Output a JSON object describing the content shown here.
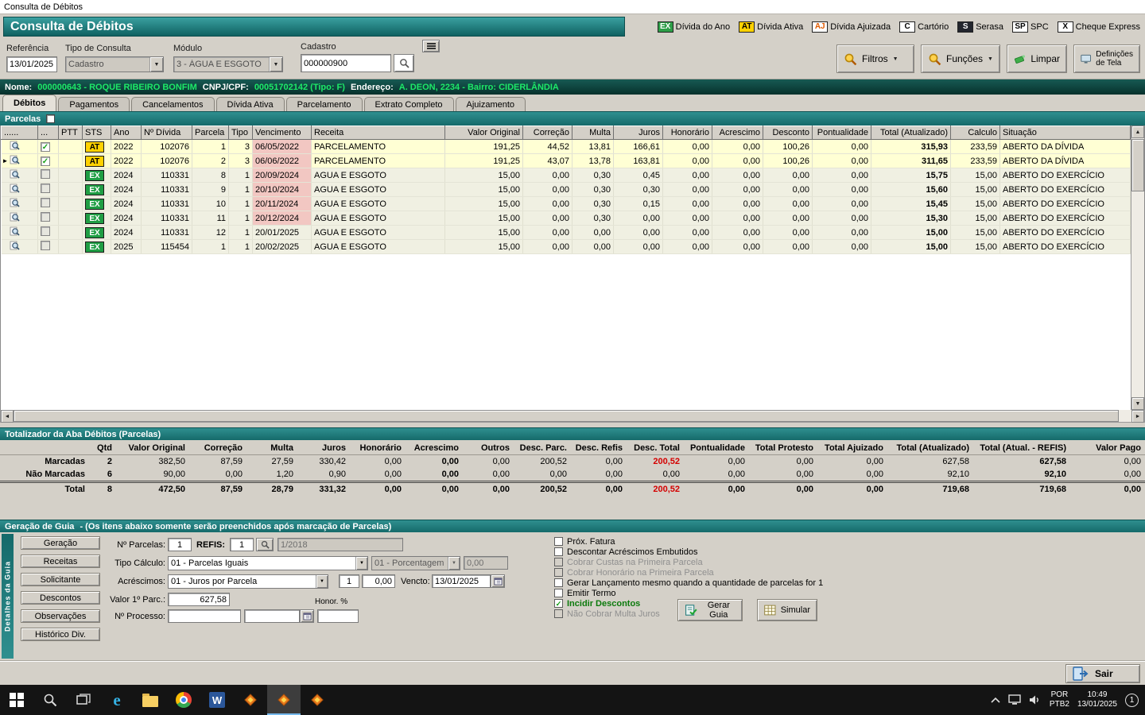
{
  "window": {
    "title": "Consulta de Débitos"
  },
  "header": {
    "title": "Consulta de Débitos",
    "legend": [
      {
        "badge": "EX",
        "label": "Dívida do Ano",
        "bg": "#2e9e48",
        "fg": "#ffffff"
      },
      {
        "badge": "AT",
        "label": "Dívida Ativa",
        "bg": "#ffd200",
        "fg": "#000000"
      },
      {
        "badge": "AJ",
        "label": "Dívida Ajuizada",
        "bg": "#ffffff",
        "fg": "#e05a00"
      },
      {
        "badge": "C",
        "label": "Cartório",
        "bg": "#ffffff",
        "fg": "#000000"
      },
      {
        "badge": "S",
        "label": "Serasa",
        "bg": "#23262e",
        "fg": "#ffffff"
      },
      {
        "badge": "SP",
        "label": "SPC",
        "bg": "#ffffff",
        "fg": "#000000"
      },
      {
        "badge": "X",
        "label": "Cheque Express",
        "bg": "#ffffff",
        "fg": "#000000"
      }
    ]
  },
  "filters": {
    "referencia": {
      "label": "Referência",
      "value": "13/01/2025"
    },
    "tipo_consulta": {
      "label": "Tipo de Consulta",
      "value": "Cadastro"
    },
    "modulo": {
      "label": "Módulo",
      "value": "3 - ÁGUA E ESGOTO"
    },
    "cadastro": {
      "label": "Cadastro",
      "value": "000000900"
    }
  },
  "toolbar": {
    "filtros": "Filtros",
    "funcoes": "Funções",
    "limpar": "Limpar",
    "definicoes_line1": "Definições",
    "definicoes_line2": "de Tela"
  },
  "pessoa": {
    "nome_label": "Nome:",
    "nome": "000000643 - ROQUE RIBEIRO BONFIM",
    "doc_label": "CNPJ/CPF:",
    "doc": "00051702142 (Tipo: F)",
    "endereco_label": "Endereço:",
    "endereco": "A. DEON, 2234 - Bairro: CIDERLÂNDIA"
  },
  "tabs": {
    "items": [
      "Débitos",
      "Pagamentos",
      "Cancelamentos",
      "Dívida Ativa",
      "Parcelamento",
      "Extrato Completo",
      "Ajuizamento"
    ],
    "active_index": 0
  },
  "parcelas": {
    "title": "Parcelas"
  },
  "icons": {
    "dropdown_arrow": "▼",
    "scroll_up": "▲",
    "scroll_down": "▼",
    "scroll_left": "◄",
    "scroll_right": "►",
    "check": "✓",
    "current_row": "►"
  },
  "debitos": {
    "columns": [
      "......",
      "...",
      "PTT",
      "STS",
      "Ano",
      "Nº Dívida",
      "Parcela",
      "Tipo",
      "Vencimento",
      "Receita",
      "Valor Original",
      "Correção",
      "Multa",
      "Juros",
      "Honorário",
      "Acrescimo",
      "Desconto",
      "Pontualidade",
      "Total (Atualizado)",
      "Calculo",
      "Situação"
    ],
    "rows": [
      {
        "checked": true,
        "current": false,
        "sts": "AT",
        "ano": "2022",
        "divida": "102076",
        "parcela": "1",
        "tipo": "3",
        "venc": "06/05/2022",
        "overdue": true,
        "receita": "PARCELAMENTO",
        "valor": "191,25",
        "correcao": "44,52",
        "multa": "13,81",
        "juros": "166,61",
        "honorario": "0,00",
        "acrescimo": "0,00",
        "desconto": "100,26",
        "pontualidade": "0,00",
        "total": "315,93",
        "calculo": "233,59",
        "situacao": "ABERTO DA DÍVIDA"
      },
      {
        "checked": true,
        "current": true,
        "sts": "AT",
        "ano": "2022",
        "divida": "102076",
        "parcela": "2",
        "tipo": "3",
        "venc": "06/06/2022",
        "overdue": true,
        "receita": "PARCELAMENTO",
        "valor": "191,25",
        "correcao": "43,07",
        "multa": "13,78",
        "juros": "163,81",
        "honorario": "0,00",
        "acrescimo": "0,00",
        "desconto": "100,26",
        "pontualidade": "0,00",
        "total": "311,65",
        "calculo": "233,59",
        "situacao": "ABERTO DA DÍVIDA"
      },
      {
        "checked": false,
        "current": false,
        "sts": "EX",
        "ano": "2024",
        "divida": "110331",
        "parcela": "8",
        "tipo": "1",
        "venc": "20/09/2024",
        "overdue": true,
        "receita": "AGUA E ESGOTO",
        "valor": "15,00",
        "correcao": "0,00",
        "multa": "0,30",
        "juros": "0,45",
        "honorario": "0,00",
        "acrescimo": "0,00",
        "desconto": "0,00",
        "pontualidade": "0,00",
        "total": "15,75",
        "calculo": "15,00",
        "situacao": "ABERTO DO EXERCÍCIO"
      },
      {
        "checked": false,
        "current": false,
        "sts": "EX",
        "ano": "2024",
        "divida": "110331",
        "parcela": "9",
        "tipo": "1",
        "venc": "20/10/2024",
        "overdue": true,
        "receita": "AGUA E ESGOTO",
        "valor": "15,00",
        "correcao": "0,00",
        "multa": "0,30",
        "juros": "0,30",
        "honorario": "0,00",
        "acrescimo": "0,00",
        "desconto": "0,00",
        "pontualidade": "0,00",
        "total": "15,60",
        "calculo": "15,00",
        "situacao": "ABERTO DO EXERCÍCIO"
      },
      {
        "checked": false,
        "current": false,
        "sts": "EX",
        "ano": "2024",
        "divida": "110331",
        "parcela": "10",
        "tipo": "1",
        "venc": "20/11/2024",
        "overdue": true,
        "receita": "AGUA E ESGOTO",
        "valor": "15,00",
        "correcao": "0,00",
        "multa": "0,30",
        "juros": "0,15",
        "honorario": "0,00",
        "acrescimo": "0,00",
        "desconto": "0,00",
        "pontualidade": "0,00",
        "total": "15,45",
        "calculo": "15,00",
        "situacao": "ABERTO DO EXERCÍCIO"
      },
      {
        "checked": false,
        "current": false,
        "sts": "EX",
        "ano": "2024",
        "divida": "110331",
        "parcela": "11",
        "tipo": "1",
        "venc": "20/12/2024",
        "overdue": true,
        "receita": "AGUA E ESGOTO",
        "valor": "15,00",
        "correcao": "0,00",
        "multa": "0,30",
        "juros": "0,00",
        "honorario": "0,00",
        "acrescimo": "0,00",
        "desconto": "0,00",
        "pontualidade": "0,00",
        "total": "15,30",
        "calculo": "15,00",
        "situacao": "ABERTO DO EXERCÍCIO"
      },
      {
        "checked": false,
        "current": false,
        "sts": "EX",
        "ano": "2024",
        "divida": "110331",
        "parcela": "12",
        "tipo": "1",
        "venc": "20/01/2025",
        "overdue": false,
        "receita": "AGUA E ESGOTO",
        "valor": "15,00",
        "correcao": "0,00",
        "multa": "0,00",
        "juros": "0,00",
        "honorario": "0,00",
        "acrescimo": "0,00",
        "desconto": "0,00",
        "pontualidade": "0,00",
        "total": "15,00",
        "calculo": "15,00",
        "situacao": "ABERTO DO EXERCÍCIO"
      },
      {
        "checked": false,
        "current": false,
        "sts": "EX",
        "ano": "2025",
        "divida": "115454",
        "parcela": "1",
        "tipo": "1",
        "venc": "20/02/2025",
        "overdue": false,
        "receita": "AGUA E ESGOTO",
        "valor": "15,00",
        "correcao": "0,00",
        "multa": "0,00",
        "juros": "0,00",
        "honorario": "0,00",
        "acrescimo": "0,00",
        "desconto": "0,00",
        "pontualidade": "0,00",
        "total": "15,00",
        "calculo": "15,00",
        "situacao": "ABERTO DO EXERCÍCIO"
      }
    ]
  },
  "totalizador": {
    "title": "Totalizador da Aba Débitos (Parcelas)",
    "columns": [
      "",
      "Qtd",
      "Valor Original",
      "Correção",
      "Multa",
      "Juros",
      "Honorário",
      "Acrescimo",
      "Outros",
      "Desc. Parc.",
      "Desc. Refis",
      "Desc. Total",
      "Pontualidade",
      "Total Protesto",
      "Total Ajuizado",
      "Total (Atualizado)",
      "Total (Atual. - REFIS)",
      "Valor Pago"
    ],
    "rows": [
      {
        "label": "Marcadas",
        "qtd": "2",
        "valor": "382,50",
        "correcao": "87,59",
        "multa": "27,59",
        "juros": "330,42",
        "honorario": "0,00",
        "acrescimo": "0,00",
        "outros": "0,00",
        "desc_parc": "200,52",
        "desc_refis": "0,00",
        "desc_total": "200,52",
        "desc_total_red": true,
        "pontualidade": "0,00",
        "protesto": "0,00",
        "ajuizado": "0,00",
        "total_atual": "627,58",
        "total_refis": "627,58",
        "pago": "0,00",
        "is_total": false
      },
      {
        "label": "Não Marcadas",
        "qtd": "6",
        "valor": "90,00",
        "correcao": "0,00",
        "multa": "1,20",
        "juros": "0,90",
        "honorario": "0,00",
        "acrescimo": "0,00",
        "outros": "0,00",
        "desc_parc": "0,00",
        "desc_refis": "0,00",
        "desc_total": "0,00",
        "desc_total_red": false,
        "pontualidade": "0,00",
        "protesto": "0,00",
        "ajuizado": "0,00",
        "total_atual": "92,10",
        "total_refis": "92,10",
        "pago": "0,00",
        "is_total": false
      },
      {
        "label": "Total",
        "qtd": "8",
        "valor": "472,50",
        "correcao": "87,59",
        "multa": "28,79",
        "juros": "331,32",
        "honorario": "0,00",
        "acrescimo": "0,00",
        "outros": "0,00",
        "desc_parc": "200,52",
        "desc_refis": "0,00",
        "desc_total": "200,52",
        "desc_total_red": true,
        "pontualidade": "0,00",
        "protesto": "0,00",
        "ajuizado": "0,00",
        "total_atual": "719,68",
        "total_refis": "719,68",
        "pago": "0,00",
        "is_total": true
      }
    ]
  },
  "guia": {
    "title": "Geração de Guia",
    "subtitle": "-   (Os itens abaixo somente serão preenchidos após marcação de Parcelas)",
    "side_label": "Detalhes da Guia",
    "side_buttons": [
      "Geração",
      "Receitas",
      "Solicitante",
      "Descontos",
      "Observações",
      "Histórico Div."
    ],
    "fields": {
      "n_parcelas_label": "Nº Parcelas:",
      "n_parcelas": "1",
      "refis_label": "REFIS:",
      "refis": "1",
      "refis_ref": "1/2018",
      "tipo_calculo_label": "Tipo Cálculo:",
      "tipo_calculo": "01 - Parcelas Iguais",
      "porcentagem": "01 - Porcentagem",
      "porcentagem_valor": "0,00",
      "acrescimos_label": "Acréscimos:",
      "acrescimos": "01 - Juros por Parcela",
      "acrescimos_qtd": "1",
      "acrescimos_valor": "0,00",
      "vencto_label": "Vencto:",
      "vencto": "13/01/2025",
      "valor1_label": "Valor 1º Parc.:",
      "valor1": "627,58",
      "honor_label": "Honor. %",
      "honor_valor": "",
      "processo_label": "Nº Processo:",
      "processo": "",
      "processo_data": ""
    },
    "checkboxes": [
      {
        "label": "Próx. Fatura",
        "checked": false,
        "disabled": false
      },
      {
        "label": "Descontar Acréscimos Embutidos",
        "checked": false,
        "disabled": false
      },
      {
        "label": "Cobrar Custas na Primeira Parcela",
        "checked": false,
        "disabled": true
      },
      {
        "label": "Cobrar Honorário na Primeira Parcela",
        "checked": false,
        "disabled": true
      },
      {
        "label": "Gerar Lançamento mesmo quando a quantidade de parcelas for 1",
        "checked": false,
        "disabled": false
      },
      {
        "label": "Emitir Termo",
        "checked": false,
        "disabled": false
      },
      {
        "label": "Incidir Descontos",
        "checked": true,
        "disabled": false
      },
      {
        "label": "Não Cobrar Multa Juros",
        "checked": false,
        "disabled": true
      }
    ],
    "gerar_guia": "Gerar Guia",
    "simular": "Simular"
  },
  "sair": "Sair",
  "taskbar": {
    "lang": "POR",
    "layout": "PTB2",
    "time": "10:49",
    "date": "13/01/2025",
    "badge": "1"
  }
}
